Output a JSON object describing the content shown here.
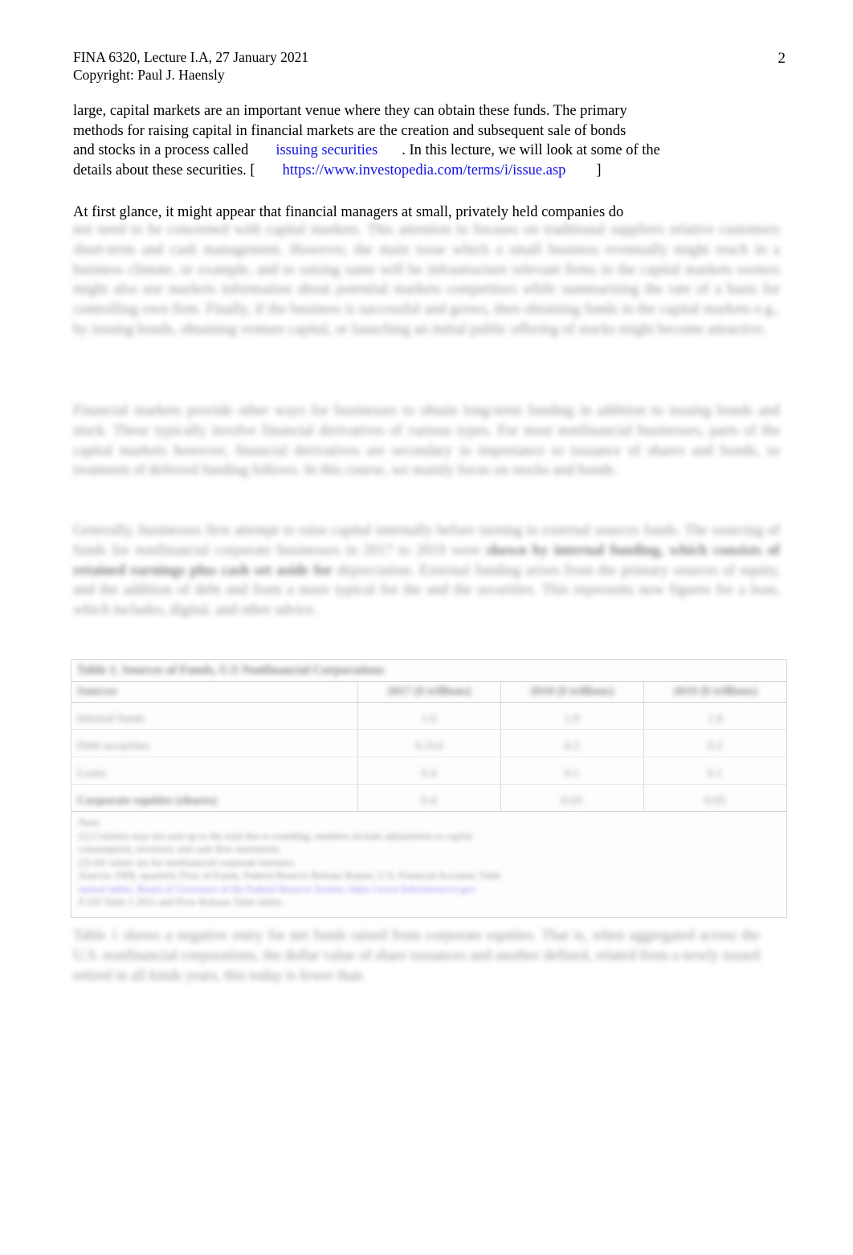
{
  "document": {
    "header": {
      "line1": "FINA 6320, Lecture I.A, 27 January 2021",
      "line2": "Copyright: Paul J. Haensly"
    },
    "page_number": "2"
  },
  "paragraph_1": {
    "line1": "large, capital markets are an important venue where they can obtain these funds. The primary",
    "line2": "methods for raising capital in financial markets are the creation and subsequent sale of bonds",
    "line3_pre": "and stocks in a process called",
    "line3_link": "issuing securities",
    "line3_post": ". In this lecture, we will look at some of the",
    "line4_pre": "details about these securities. [",
    "line4_link": "https://www.investopedia.com/terms/i/issue.asp",
    "line4_post": "]"
  },
  "paragraph_2": {
    "line1": "At first glance, it might appear that financial managers at small, privately held companies do",
    "blurred_lines": [
      "not need to be concerned with capital markets. This attention to focuses on traditional",
      "suppliers relative customers short-term and cash management. However, the main issue",
      "which a small business eventually might reach in a business climate, or example, and to raising",
      "same will be infrastructure relevant firms in the capital markets  owners might also use markets",
      "information about potential markets competitors while summarizing the rate of a basis for controlling",
      "own firm. Finally, if the business is successful and grows, then obtaining funds in the capital",
      "markets e.g., by issuing bonds, obtaining venture capital, or launching an initial public offering",
      "of stocks might become attractive."
    ]
  },
  "paragraph_3": {
    "blurred_lines": [
      "Financial markets provide other ways for businesses to obtain long-term funding in addition to",
      "issuing bonds and stock. These typically involve financial derivatives of various types. For most",
      "nonfinancial businesses, parts of the capital markets  however, financial derivatives are",
      "secondary in importance to issuance of shares and bonds, so treatment of deferred funding",
      "follows. In this course, we mainly focus on stocks and bonds."
    ]
  },
  "paragraph_4": {
    "blurred_lines": [
      "Generally, businesses first attempt to raise capital internally before turning to external sources",
      "funds. The sourcing of funds for nonfinancial corporate businesses in 2017 to 2019 were",
      "shown by internal funding, which consists of retained earnings plus cash set aside for",
      "depreciation. External funding arises from the primary sources of equity, and the addition of debt",
      "and from a more typical for the and the securities. This represents new figures for a loan, which",
      "includes, digital, and other advice."
    ]
  },
  "table": {
    "title": "Table 1. Sources of Funds, U.S Nonfinancial Corporations",
    "columns": [
      "Sources",
      "2017 ($ trillions)",
      "2018 ($ trillions)",
      "2019 ($ trillions)"
    ],
    "rows": [
      {
        "label": "Internal funds",
        "values": [
          "1.6",
          "1.8",
          "1.8"
        ]
      },
      {
        "label": "Debt securities",
        "values": [
          "0.314",
          "0.2",
          "0.2"
        ]
      },
      {
        "label": "Loans",
        "values": [
          "0.4",
          "0.1",
          "0.1"
        ]
      },
      {
        "label": "Corporate equities (shares)",
        "values": [
          "0.4",
          "0.03",
          "0.05"
        ]
      }
    ],
    "notes": [
      "Note:",
      "(1) Columns may not sum up to the total due to rounding; numbers include adjustments to capital",
      "consumption, inventory and cash flow statements.",
      "(2) All values are for nonfinancial corporate business.",
      "Sources: FRB, quarterly Flow of Funds, Federal Reserve Release Report, U.S. Financial Accounts Table",
      "annual tables, Board of Governors of the Federal Reserve System, https://www.federalreserve.gov",
      "F.103 Table 1 2021 and Flow Release Table tables."
    ]
  },
  "paragraph_5": {
    "blurred_lines": [
      "Table 1 shows a negative entry for net funds raised from corporate equities. That is, when",
      "aggregated across the U.S. nonfinancial corporations, the dollar value of share issuances",
      "and another defined, related from a newly issued retired in all kinds years, this today is fewer than"
    ]
  }
}
